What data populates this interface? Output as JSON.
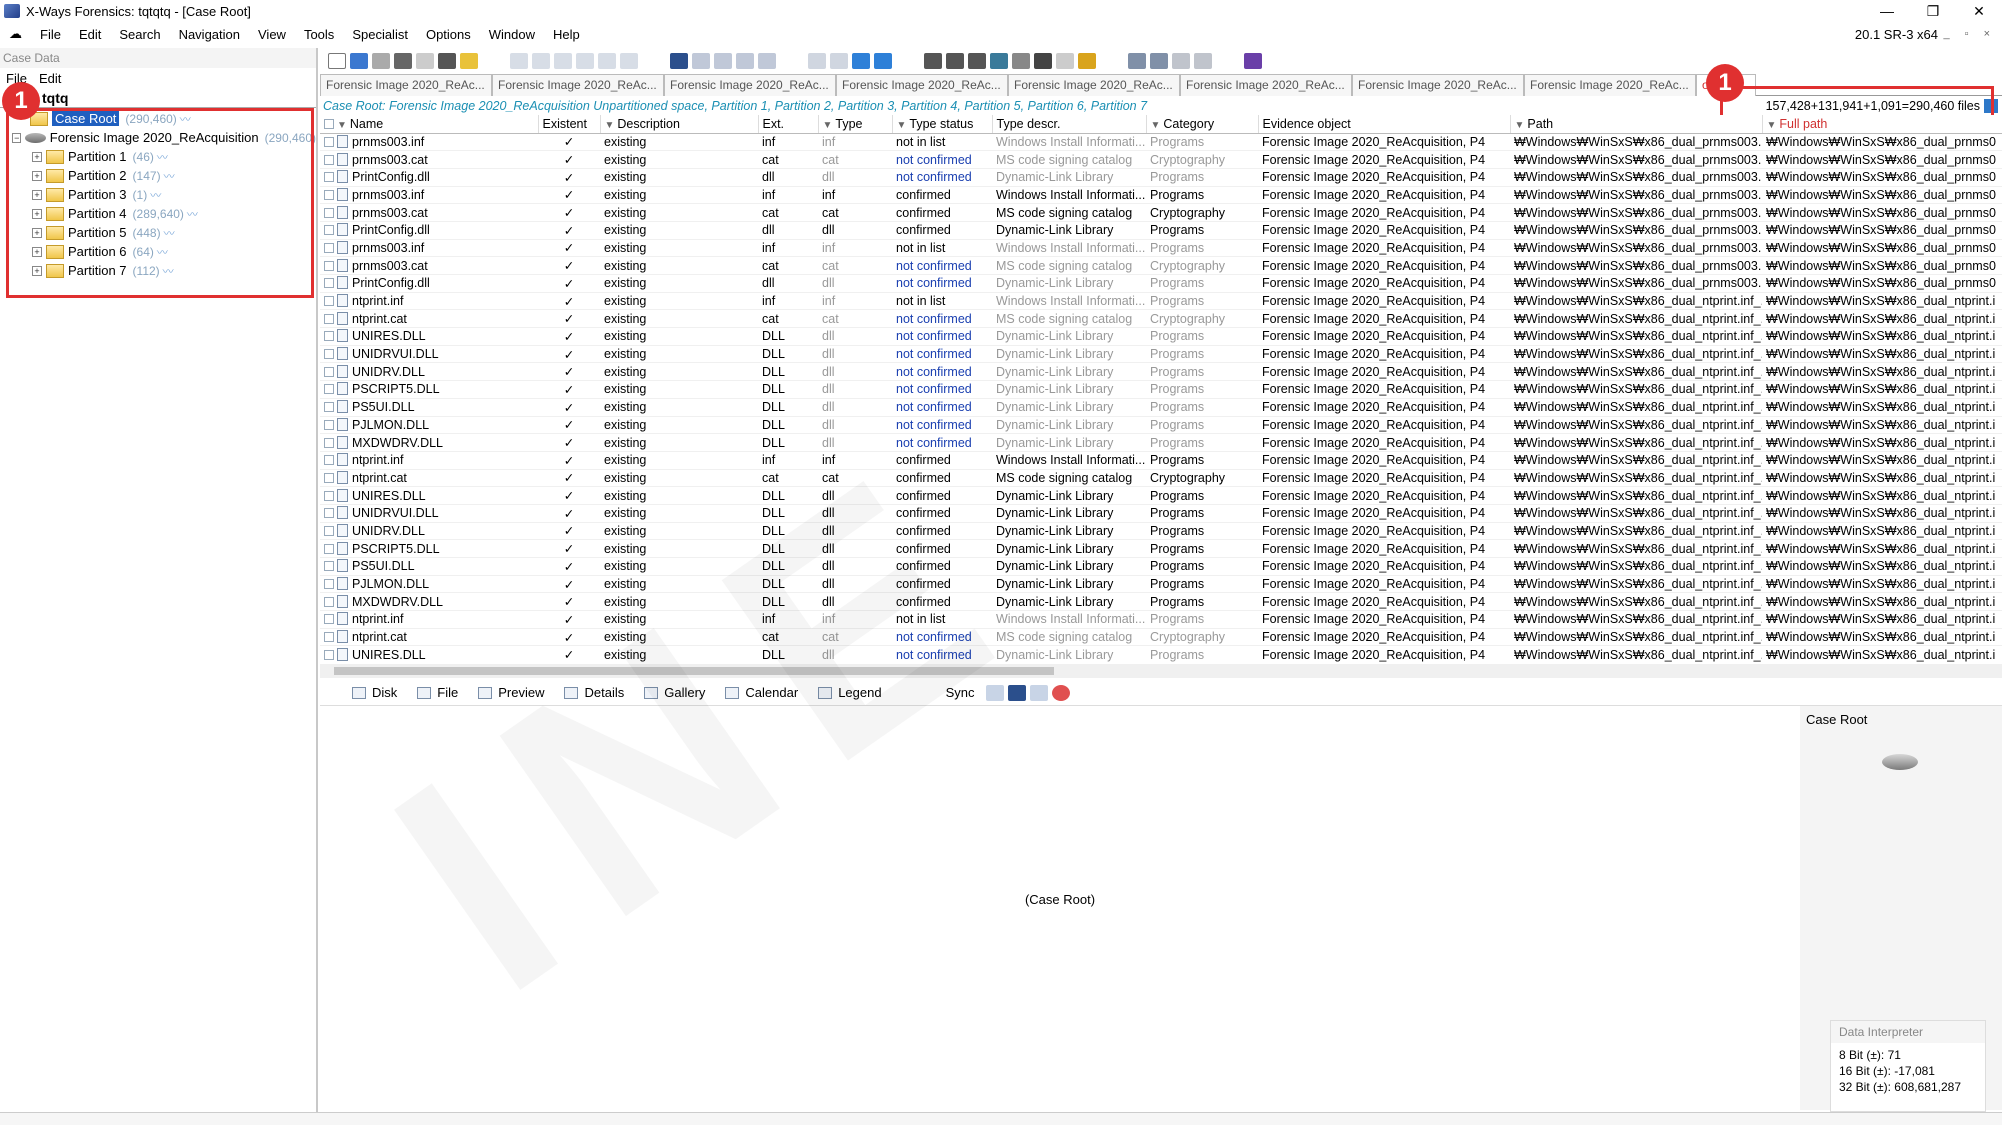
{
  "window": {
    "title": "X-Ways Forensics: tqtqtq - [Case Root]",
    "controls": [
      "—",
      "❐",
      "✕"
    ]
  },
  "menubar": {
    "items": [
      "File",
      "Edit",
      "Search",
      "Navigation",
      "View",
      "Tools",
      "Specialist",
      "Options",
      "Window",
      "Help"
    ],
    "version": "20.1 SR-3 x64",
    "mdi_buttons": "_ ▫ ×"
  },
  "case_panel": {
    "header": "Case Data",
    "menu": [
      "File",
      "Edit"
    ],
    "case_name": "tqtq",
    "root": {
      "label": "Case Root",
      "count": "(290,460)"
    },
    "evidence": {
      "label": "Forensic Image 2020_ReAcquisition",
      "count": "(290,460)"
    },
    "partitions": [
      {
        "label": "Partition 1",
        "count": "(46)"
      },
      {
        "label": "Partition 2",
        "count": "(147)"
      },
      {
        "label": "Partition 3",
        "count": "(1)"
      },
      {
        "label": "Partition 4",
        "count": "(289,640)"
      },
      {
        "label": "Partition 5",
        "count": "(448)"
      },
      {
        "label": "Partition 6",
        "count": "(64)"
      },
      {
        "label": "Partition 7",
        "count": "(112)"
      }
    ],
    "annotation": "1"
  },
  "tabs": [
    "Forensic Image 2020_ReAc...",
    "Forensic Image 2020_ReAc...",
    "Forensic Image 2020_ReAc...",
    "Forensic Image 2020_ReAc...",
    "Forensic Image 2020_ReAc...",
    "Forensic Image 2020_ReAc...",
    "Forensic Image 2020_ReAc...",
    "Forensic Image 2020_ReAc..."
  ],
  "active_tab": "oot",
  "path_line": "Case Root: Forensic Image 2020_ReAcquisition Unpartitioned space, Partition 1, Partition 2, Partition 3, Partition 4, Partition 5, Partition 6, Partition 7",
  "file_count": "157,428+131,941+1,091=290,460 files",
  "count_annotation": "1",
  "columns": [
    "Name",
    "Existent",
    "Description",
    "Ext.",
    "Type",
    "Type status",
    "Type descr.",
    "Category",
    "Evidence object",
    "Path",
    "Full path"
  ],
  "rows": [
    [
      "prnms003.inf",
      "✓",
      "existing",
      "inf",
      "inf",
      "not in list",
      "Windows Install Informati...",
      "Programs",
      "Forensic Image 2020_ReAcquisition, P4",
      "₩Windows₩WinSxS₩x86_dual_prnms003....",
      "₩Windows₩WinSxS₩x86_dual_prnms0"
    ],
    [
      "prnms003.cat",
      "✓",
      "existing",
      "cat",
      "cat",
      "not confirmed",
      "MS code signing catalog",
      "Cryptography",
      "Forensic Image 2020_ReAcquisition, P4",
      "₩Windows₩WinSxS₩x86_dual_prnms003....",
      "₩Windows₩WinSxS₩x86_dual_prnms0"
    ],
    [
      "PrintConfig.dll",
      "✓",
      "existing",
      "dll",
      "dll",
      "not confirmed",
      "Dynamic-Link Library",
      "Programs",
      "Forensic Image 2020_ReAcquisition, P4",
      "₩Windows₩WinSxS₩x86_dual_prnms003....",
      "₩Windows₩WinSxS₩x86_dual_prnms0"
    ],
    [
      "prnms003.inf",
      "✓",
      "existing",
      "inf",
      "inf",
      "confirmed",
      "Windows Install Informati...",
      "Programs",
      "Forensic Image 2020_ReAcquisition, P4",
      "₩Windows₩WinSxS₩x86_dual_prnms003....",
      "₩Windows₩WinSxS₩x86_dual_prnms0"
    ],
    [
      "prnms003.cat",
      "✓",
      "existing",
      "cat",
      "cat",
      "confirmed",
      "MS code signing catalog",
      "Cryptography",
      "Forensic Image 2020_ReAcquisition, P4",
      "₩Windows₩WinSxS₩x86_dual_prnms003....",
      "₩Windows₩WinSxS₩x86_dual_prnms0"
    ],
    [
      "PrintConfig.dll",
      "✓",
      "existing",
      "dll",
      "dll",
      "confirmed",
      "Dynamic-Link Library",
      "Programs",
      "Forensic Image 2020_ReAcquisition, P4",
      "₩Windows₩WinSxS₩x86_dual_prnms003....",
      "₩Windows₩WinSxS₩x86_dual_prnms0"
    ],
    [
      "prnms003.inf",
      "✓",
      "existing",
      "inf",
      "inf",
      "not in list",
      "Windows Install Informati...",
      "Programs",
      "Forensic Image 2020_ReAcquisition, P4",
      "₩Windows₩WinSxS₩x86_dual_prnms003....",
      "₩Windows₩WinSxS₩x86_dual_prnms0"
    ],
    [
      "prnms003.cat",
      "✓",
      "existing",
      "cat",
      "cat",
      "not confirmed",
      "MS code signing catalog",
      "Cryptography",
      "Forensic Image 2020_ReAcquisition, P4",
      "₩Windows₩WinSxS₩x86_dual_prnms003....",
      "₩Windows₩WinSxS₩x86_dual_prnms0"
    ],
    [
      "PrintConfig.dll",
      "✓",
      "existing",
      "dll",
      "dll",
      "not confirmed",
      "Dynamic-Link Library",
      "Programs",
      "Forensic Image 2020_ReAcquisition, P4",
      "₩Windows₩WinSxS₩x86_dual_prnms003....",
      "₩Windows₩WinSxS₩x86_dual_prnms0"
    ],
    [
      "ntprint.inf",
      "✓",
      "existing",
      "inf",
      "inf",
      "not in list",
      "Windows Install Informati...",
      "Programs",
      "Forensic Image 2020_ReAcquisition, P4",
      "₩Windows₩WinSxS₩x86_dual_ntprint.inf_...",
      "₩Windows₩WinSxS₩x86_dual_ntprint.i"
    ],
    [
      "ntprint.cat",
      "✓",
      "existing",
      "cat",
      "cat",
      "not confirmed",
      "MS code signing catalog",
      "Cryptography",
      "Forensic Image 2020_ReAcquisition, P4",
      "₩Windows₩WinSxS₩x86_dual_ntprint.inf_...",
      "₩Windows₩WinSxS₩x86_dual_ntprint.i"
    ],
    [
      "UNIRES.DLL",
      "✓",
      "existing",
      "DLL",
      "dll",
      "not confirmed",
      "Dynamic-Link Library",
      "Programs",
      "Forensic Image 2020_ReAcquisition, P4",
      "₩Windows₩WinSxS₩x86_dual_ntprint.inf_...",
      "₩Windows₩WinSxS₩x86_dual_ntprint.i"
    ],
    [
      "UNIDRVUI.DLL",
      "✓",
      "existing",
      "DLL",
      "dll",
      "not confirmed",
      "Dynamic-Link Library",
      "Programs",
      "Forensic Image 2020_ReAcquisition, P4",
      "₩Windows₩WinSxS₩x86_dual_ntprint.inf_...",
      "₩Windows₩WinSxS₩x86_dual_ntprint.i"
    ],
    [
      "UNIDRV.DLL",
      "✓",
      "existing",
      "DLL",
      "dll",
      "not confirmed",
      "Dynamic-Link Library",
      "Programs",
      "Forensic Image 2020_ReAcquisition, P4",
      "₩Windows₩WinSxS₩x86_dual_ntprint.inf_...",
      "₩Windows₩WinSxS₩x86_dual_ntprint.i"
    ],
    [
      "PSCRIPT5.DLL",
      "✓",
      "existing",
      "DLL",
      "dll",
      "not confirmed",
      "Dynamic-Link Library",
      "Programs",
      "Forensic Image 2020_ReAcquisition, P4",
      "₩Windows₩WinSxS₩x86_dual_ntprint.inf_...",
      "₩Windows₩WinSxS₩x86_dual_ntprint.i"
    ],
    [
      "PS5UI.DLL",
      "✓",
      "existing",
      "DLL",
      "dll",
      "not confirmed",
      "Dynamic-Link Library",
      "Programs",
      "Forensic Image 2020_ReAcquisition, P4",
      "₩Windows₩WinSxS₩x86_dual_ntprint.inf_...",
      "₩Windows₩WinSxS₩x86_dual_ntprint.i"
    ],
    [
      "PJLMON.DLL",
      "✓",
      "existing",
      "DLL",
      "dll",
      "not confirmed",
      "Dynamic-Link Library",
      "Programs",
      "Forensic Image 2020_ReAcquisition, P4",
      "₩Windows₩WinSxS₩x86_dual_ntprint.inf_...",
      "₩Windows₩WinSxS₩x86_dual_ntprint.i"
    ],
    [
      "MXDWDRV.DLL",
      "✓",
      "existing",
      "DLL",
      "dll",
      "not confirmed",
      "Dynamic-Link Library",
      "Programs",
      "Forensic Image 2020_ReAcquisition, P4",
      "₩Windows₩WinSxS₩x86_dual_ntprint.inf_...",
      "₩Windows₩WinSxS₩x86_dual_ntprint.i"
    ],
    [
      "ntprint.inf",
      "✓",
      "existing",
      "inf",
      "inf",
      "confirmed",
      "Windows Install Informati...",
      "Programs",
      "Forensic Image 2020_ReAcquisition, P4",
      "₩Windows₩WinSxS₩x86_dual_ntprint.inf_...",
      "₩Windows₩WinSxS₩x86_dual_ntprint.i"
    ],
    [
      "ntprint.cat",
      "✓",
      "existing",
      "cat",
      "cat",
      "confirmed",
      "MS code signing catalog",
      "Cryptography",
      "Forensic Image 2020_ReAcquisition, P4",
      "₩Windows₩WinSxS₩x86_dual_ntprint.inf_...",
      "₩Windows₩WinSxS₩x86_dual_ntprint.i"
    ],
    [
      "UNIRES.DLL",
      "✓",
      "existing",
      "DLL",
      "dll",
      "confirmed",
      "Dynamic-Link Library",
      "Programs",
      "Forensic Image 2020_ReAcquisition, P4",
      "₩Windows₩WinSxS₩x86_dual_ntprint.inf_...",
      "₩Windows₩WinSxS₩x86_dual_ntprint.i"
    ],
    [
      "UNIDRVUI.DLL",
      "✓",
      "existing",
      "DLL",
      "dll",
      "confirmed",
      "Dynamic-Link Library",
      "Programs",
      "Forensic Image 2020_ReAcquisition, P4",
      "₩Windows₩WinSxS₩x86_dual_ntprint.inf_...",
      "₩Windows₩WinSxS₩x86_dual_ntprint.i"
    ],
    [
      "UNIDRV.DLL",
      "✓",
      "existing",
      "DLL",
      "dll",
      "confirmed",
      "Dynamic-Link Library",
      "Programs",
      "Forensic Image 2020_ReAcquisition, P4",
      "₩Windows₩WinSxS₩x86_dual_ntprint.inf_...",
      "₩Windows₩WinSxS₩x86_dual_ntprint.i"
    ],
    [
      "PSCRIPT5.DLL",
      "✓",
      "existing",
      "DLL",
      "dll",
      "confirmed",
      "Dynamic-Link Library",
      "Programs",
      "Forensic Image 2020_ReAcquisition, P4",
      "₩Windows₩WinSxS₩x86_dual_ntprint.inf_...",
      "₩Windows₩WinSxS₩x86_dual_ntprint.i"
    ],
    [
      "PS5UI.DLL",
      "✓",
      "existing",
      "DLL",
      "dll",
      "confirmed",
      "Dynamic-Link Library",
      "Programs",
      "Forensic Image 2020_ReAcquisition, P4",
      "₩Windows₩WinSxS₩x86_dual_ntprint.inf_...",
      "₩Windows₩WinSxS₩x86_dual_ntprint.i"
    ],
    [
      "PJLMON.DLL",
      "✓",
      "existing",
      "DLL",
      "dll",
      "confirmed",
      "Dynamic-Link Library",
      "Programs",
      "Forensic Image 2020_ReAcquisition, P4",
      "₩Windows₩WinSxS₩x86_dual_ntprint.inf_...",
      "₩Windows₩WinSxS₩x86_dual_ntprint.i"
    ],
    [
      "MXDWDRV.DLL",
      "✓",
      "existing",
      "DLL",
      "dll",
      "confirmed",
      "Dynamic-Link Library",
      "Programs",
      "Forensic Image 2020_ReAcquisition, P4",
      "₩Windows₩WinSxS₩x86_dual_ntprint.inf_...",
      "₩Windows₩WinSxS₩x86_dual_ntprint.i"
    ],
    [
      "ntprint.inf",
      "✓",
      "existing",
      "inf",
      "inf",
      "not in list",
      "Windows Install Informati...",
      "Programs",
      "Forensic Image 2020_ReAcquisition, P4",
      "₩Windows₩WinSxS₩x86_dual_ntprint.inf_...",
      "₩Windows₩WinSxS₩x86_dual_ntprint.i"
    ],
    [
      "ntprint.cat",
      "✓",
      "existing",
      "cat",
      "cat",
      "not confirmed",
      "MS code signing catalog",
      "Cryptography",
      "Forensic Image 2020_ReAcquisition, P4",
      "₩Windows₩WinSxS₩x86_dual_ntprint.inf_...",
      "₩Windows₩WinSxS₩x86_dual_ntprint.i"
    ],
    [
      "UNIRES.DLL",
      "✓",
      "existing",
      "DLL",
      "dll",
      "not confirmed",
      "Dynamic-Link Library",
      "Programs",
      "Forensic Image 2020_ReAcquisition, P4",
      "₩Windows₩WinSxS₩x86_dual_ntprint.inf_...",
      "₩Windows₩WinSxS₩x86_dual_ntprint.i"
    ]
  ],
  "bottom_tabs": [
    "Disk",
    "File",
    "Preview",
    "Details",
    "Gallery",
    "Calendar",
    "Legend",
    "Sync"
  ],
  "preview": {
    "center_text": "(Case Root)",
    "side_label": "Case Root"
  },
  "data_interpreter": {
    "title": "Data Interpreter",
    "lines": [
      "8 Bit (±): 71",
      "16 Bit (±): -17,081",
      "32 Bit (±): 608,681,287"
    ]
  },
  "colors": {
    "highlight_red": "#e03030",
    "selection_blue": "#1f5fbf",
    "not_confirmed_blue": "#1a3fb0"
  }
}
